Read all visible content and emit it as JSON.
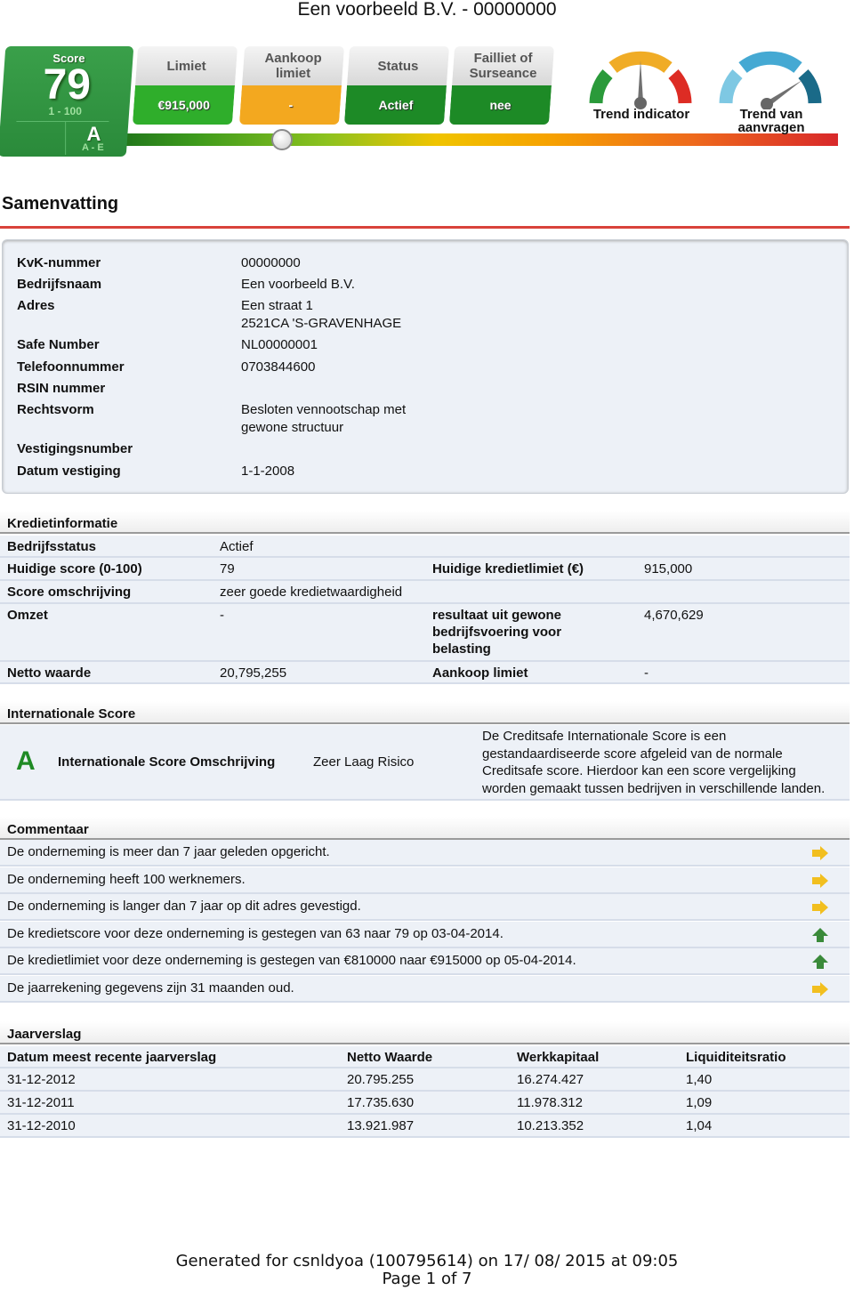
{
  "document_title": "Een voorbeeld B.V. - 00000000",
  "banner": {
    "score": {
      "label": "Score",
      "value": "79",
      "range": "1 - 100",
      "letter": "A",
      "letter_range": "A - E"
    },
    "tiles": [
      {
        "header": "Limiet",
        "value": "€915,000",
        "color": "#2fae2b"
      },
      {
        "header": "Aankoop limiet",
        "value": "-",
        "color": "#f3a81f"
      },
      {
        "header": "Status",
        "value": "Actief",
        "color": "#1d8a26"
      },
      {
        "header": "Failliet of Surseance",
        "value": "nee",
        "color": "#1d8a26"
      }
    ],
    "score_bar_position": 0.24,
    "gauges": [
      {
        "label": "Trend indicator",
        "needle": "center"
      },
      {
        "label": "Trend van aanvragen",
        "needle": "right"
      }
    ]
  },
  "summary": {
    "title": "Samenvatting",
    "rows": [
      {
        "label": "KvK-nummer",
        "value": "00000000"
      },
      {
        "label": "Bedrijfsnaam",
        "value": "Een voorbeeld B.V."
      },
      {
        "label": "Adres",
        "value": "Een straat 1",
        "value2": "2521CA  'S-GRAVENHAGE"
      },
      {
        "label": "Safe Number",
        "value": "NL00000001"
      },
      {
        "label": "Telefoonnummer",
        "value": "0703844600"
      },
      {
        "label": "RSIN nummer",
        "value": ""
      },
      {
        "label": "Rechtsvorm",
        "value": "Besloten vennootschap met",
        "value2": "gewone structuur"
      },
      {
        "label": "Vestigingsnumber",
        "value": ""
      },
      {
        "label": "Datum vestiging",
        "value": "1-1-2008"
      }
    ]
  },
  "credit": {
    "title": "Kredietinformatie",
    "bedrijfsstatus_label": "Bedrijfsstatus",
    "bedrijfsstatus_value": "Actief",
    "score_label": "Huidige score (0-100)",
    "score_value": "79",
    "limit_label": "Huidige kredietlimiet (€)",
    "limit_value": "915,000",
    "omschrijving_label": "Score omschrijving",
    "omschrijving_value": "zeer goede kredietwaardigheid",
    "omzet_label": "Omzet",
    "omzet_value": "-",
    "resultaat_label_1": "resultaat uit gewone",
    "resultaat_label_2": "bedrijfsvoering voor",
    "resultaat_label_3": "belasting",
    "resultaat_value": "4,670,629",
    "netto_label": "Netto waarde",
    "netto_value": "20,795,255",
    "aankoop_label": "Aankoop limiet",
    "aankoop_value": "-"
  },
  "international": {
    "title": "Internationale Score",
    "letter": "A",
    "desc_label": "Internationale Score Omschrijving",
    "desc_value": "Zeer Laag Risico",
    "explanation": [
      "De Creditsafe Internationale Score is een",
      "gestandaardiseerde score afgeleid van de normale",
      "Creditsafe score. Hierdoor kan een score vergelijking",
      "worden gemaakt tussen bedrijven in verschillende landen."
    ]
  },
  "comments": {
    "title": "Commentaar",
    "items": [
      {
        "text": "De onderneming is meer dan 7 jaar geleden opgericht.",
        "icon": "arrow-right-icon"
      },
      {
        "text": "De onderneming heeft 100 werknemers.",
        "icon": "arrow-right-icon"
      },
      {
        "text": "De onderneming is langer dan 7 jaar op dit adres gevestigd.",
        "icon": "arrow-right-icon"
      },
      {
        "text": "De kredietscore voor deze onderneming is gestegen van 63 naar 79 op 03-04-2014.",
        "icon": "arrow-up-icon"
      },
      {
        "text": "De kredietlimiet voor deze onderneming is gestegen van €810000 naar €915000 op 05-04-2014.",
        "icon": "arrow-up-icon"
      },
      {
        "text": "De jaarrekening gegevens zijn 31 maanden oud.",
        "icon": "arrow-right-icon"
      }
    ],
    "colors": {
      "neutral": "#f2bf1f",
      "up": "#3a8a3a"
    }
  },
  "annual": {
    "title": "Jaarverslag",
    "headers": [
      "Datum meest recente jaarverslag",
      "Netto Waarde",
      "Werkkapitaal",
      "Liquiditeitsratio"
    ],
    "rows": [
      [
        "31-12-2012",
        "20.795.255",
        "16.274.427",
        "1,40"
      ],
      [
        "31-12-2011",
        "17.735.630",
        "11.978.312",
        "1,09"
      ],
      [
        "31-12-2010",
        "13.921.987",
        "10.213.352",
        "1,04"
      ]
    ]
  },
  "footer": {
    "generated": "Generated for csnldyoa (100795614) on 17/ 08/ 2015 at 09:05",
    "page": "Page 1 of 7"
  }
}
